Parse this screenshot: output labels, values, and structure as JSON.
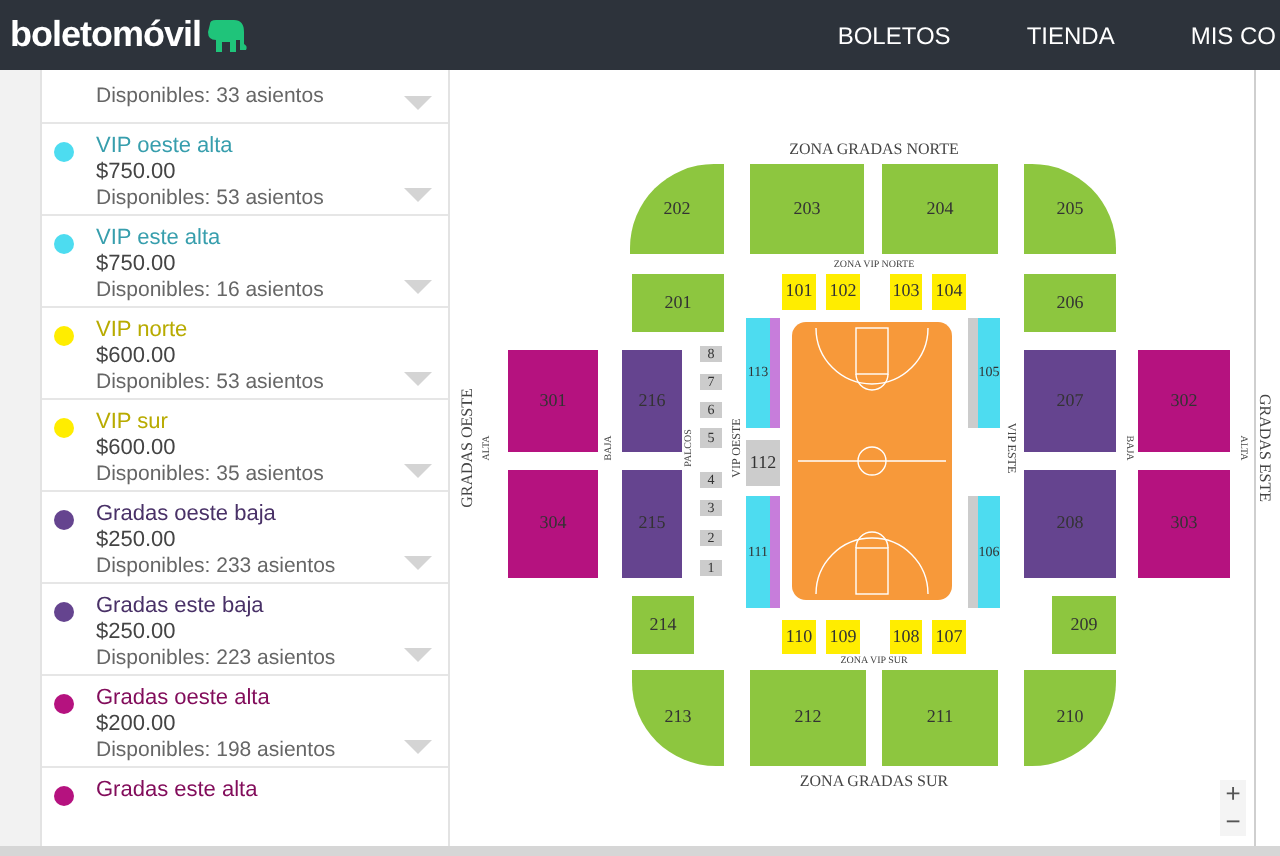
{
  "header": {
    "logo": "boletomóvil",
    "nav": [
      "BOLETOS",
      "TIENDA",
      "MIS CO"
    ]
  },
  "zones": [
    {
      "availability": "Disponibles: 33 asientos"
    },
    {
      "name": "VIP oeste alta",
      "color": "#4ddcf0",
      "price": "$750.00",
      "availability": "Disponibles: 53 asientos"
    },
    {
      "name": "VIP este alta",
      "color": "#4ddcf0",
      "price": "$750.00",
      "availability": "Disponibles: 16 asientos"
    },
    {
      "name": "VIP norte",
      "color": "#ffed00",
      "price": "$600.00",
      "availability": "Disponibles: 53 asientos"
    },
    {
      "name": "VIP sur",
      "color": "#ffed00",
      "price": "$600.00",
      "availability": "Disponibles: 35 asientos"
    },
    {
      "name": "Gradas oeste baja",
      "color": "#65448f",
      "price": "$250.00",
      "availability": "Disponibles: 233 asientos"
    },
    {
      "name": "Gradas este baja",
      "color": "#65448f",
      "price": "$250.00",
      "availability": "Disponibles: 223 asientos"
    },
    {
      "name": "Gradas oeste alta",
      "color": "#b5127f",
      "price": "$200.00",
      "availability": "Disponibles: 198 asientos"
    },
    {
      "name": "Gradas este alta",
      "color": "#b5127f"
    }
  ],
  "map": {
    "labels": [
      "ZONA GRADAS NORTE",
      "ZONA VIP NORTE",
      "GRADAS OESTE",
      "ALTA",
      "BAJA",
      "PALCOS",
      "VIP OESTE",
      "VIP ESTE",
      "BAJA",
      "ALTA",
      "GRADAS ESTE",
      "ZONA VIP SUR",
      "ZONA GRADAS SUR"
    ],
    "sections": [
      {
        "label": "202",
        "color": "#8dc63f"
      },
      {
        "label": "203",
        "color": "#8dc63f"
      },
      {
        "label": "204",
        "color": "#8dc63f"
      },
      {
        "label": "205",
        "color": "#8dc63f"
      },
      {
        "label": "201",
        "color": "#8dc63f"
      },
      {
        "label": "206",
        "color": "#8dc63f"
      },
      {
        "label": "101",
        "color": "#ffed00"
      },
      {
        "label": "102",
        "color": "#ffed00"
      },
      {
        "label": "103",
        "color": "#ffed00"
      },
      {
        "label": "104",
        "color": "#ffed00"
      },
      {
        "label": "113",
        "color": "#4ddcf0",
        "stripe": {
          "color": "#c77ddb"
        }
      },
      {
        "label": "112",
        "color": "#cccccc"
      },
      {
        "label": "111",
        "color": "#4ddcf0",
        "stripe": {
          "color": "#c77ddb"
        }
      },
      {
        "label": "105",
        "color": "#4ddcf0",
        "stripe": {
          "color": "#cccccc"
        }
      },
      {
        "label": "106",
        "color": "#4ddcf0",
        "stripe": {
          "color": "#cccccc"
        }
      },
      {
        "label": "301",
        "color": "#b5127f"
      },
      {
        "label": "304",
        "color": "#b5127f"
      },
      {
        "label": "216",
        "color": "#65448f"
      },
      {
        "label": "215",
        "color": "#65448f"
      },
      {
        "label": "8",
        "color": "#cccccc"
      },
      {
        "label": "7",
        "color": "#cccccc"
      },
      {
        "label": "6",
        "color": "#cccccc"
      },
      {
        "label": "5",
        "color": "#cccccc"
      },
      {
        "label": "4",
        "color": "#cccccc"
      },
      {
        "label": "3",
        "color": "#cccccc"
      },
      {
        "label": "2",
        "color": "#cccccc"
      },
      {
        "label": "1",
        "color": "#cccccc"
      },
      {
        "label": "207",
        "color": "#65448f"
      },
      {
        "label": "208",
        "color": "#65448f"
      },
      {
        "label": "302",
        "color": "#b5127f"
      },
      {
        "label": "303",
        "color": "#b5127f"
      },
      {
        "label": "214",
        "color": "#8dc63f"
      },
      {
        "label": "209",
        "color": "#8dc63f"
      },
      {
        "label": "110",
        "color": "#ffed00"
      },
      {
        "label": "109",
        "color": "#ffed00"
      },
      {
        "label": "108",
        "color": "#ffed00"
      },
      {
        "label": "107",
        "color": "#ffed00"
      },
      {
        "label": "213",
        "color": "#8dc63f"
      },
      {
        "label": "212",
        "color": "#8dc63f"
      },
      {
        "label": "211",
        "color": "#8dc63f"
      },
      {
        "label": "210",
        "color": "#8dc63f"
      }
    ],
    "zoom": [
      "+",
      "−"
    ]
  }
}
